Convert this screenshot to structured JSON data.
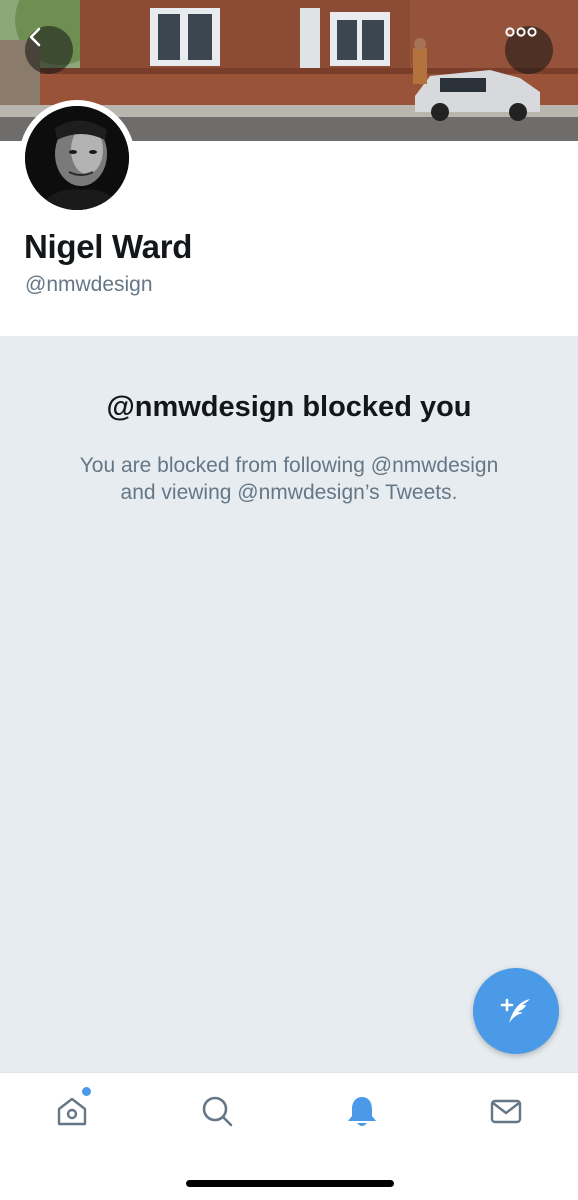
{
  "profile": {
    "display_name": "Nigel Ward",
    "handle": "@nmwdesign"
  },
  "blocked": {
    "title": "@nmwdesign blocked you",
    "message_line1": "You are blocked from following @nmwdesign",
    "message_line2": "and viewing @nmwdesign’s Tweets."
  },
  "header": {
    "back_icon": "chevron-left-icon",
    "more_icon": "more-horizontal-icon"
  },
  "fab": {
    "icon": "compose-tweet-icon"
  },
  "tabbar": {
    "items": [
      {
        "icon": "home-icon",
        "active": false,
        "has_badge": true
      },
      {
        "icon": "search-icon",
        "active": false,
        "has_badge": false
      },
      {
        "icon": "bell-icon",
        "active": true,
        "has_badge": false
      },
      {
        "icon": "mail-icon",
        "active": false,
        "has_badge": false
      }
    ]
  },
  "colors": {
    "accent": "#4a9ae8",
    "text_primary": "#14171a",
    "text_secondary": "#657786",
    "blocked_background": "#e6ecf0"
  }
}
